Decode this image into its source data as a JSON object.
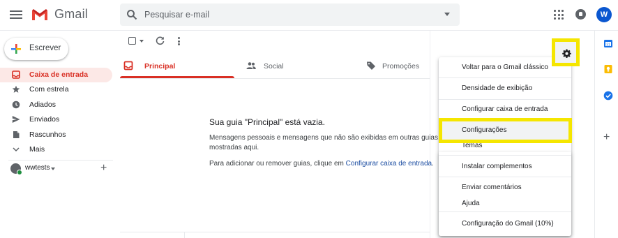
{
  "header": {
    "app_name": "Gmail",
    "search_placeholder": "Pesquisar e-mail",
    "avatar_initial": "W"
  },
  "sidebar": {
    "compose_label": "Escrever",
    "items": [
      {
        "label": "Caixa de entrada",
        "icon": "inbox-icon",
        "active": true
      },
      {
        "label": "Com estrela",
        "icon": "star-icon",
        "active": false
      },
      {
        "label": "Adiados",
        "icon": "clock-icon",
        "active": false
      },
      {
        "label": "Enviados",
        "icon": "send-icon",
        "active": false
      },
      {
        "label": "Rascunhos",
        "icon": "draft-icon",
        "active": false
      },
      {
        "label": "Mais",
        "icon": "chevron-down-icon",
        "active": false
      }
    ],
    "user": {
      "name": "wwtests"
    }
  },
  "tabs": [
    {
      "label": "Principal",
      "icon": "inbox-icon",
      "active": true
    },
    {
      "label": "Social",
      "icon": "people-icon",
      "active": false
    },
    {
      "label": "Promoções",
      "icon": "tag-icon",
      "active": false
    }
  ],
  "empty_state": {
    "title": "Sua guia \"Principal\" está vazia.",
    "line1": "Mensagens pessoais e mensagens que não são exibidas em outras guias s",
    "line2": "mostradas aqui.",
    "line3_prefix": "Para adicionar ou remover guias, clique em ",
    "line3_link": "Configurar caixa de entrada",
    "line3_suffix": "."
  },
  "settings_menu": {
    "items": [
      {
        "label": "Voltar para o Gmail clássico"
      },
      {
        "label": "Densidade de exibição"
      },
      {
        "label": "Configurar caixa de entrada"
      },
      {
        "label": "Configurações",
        "highlighted": true
      },
      {
        "label": "Temas"
      },
      {
        "label": "Instalar complementos"
      },
      {
        "label": "Enviar comentários"
      },
      {
        "label": "Ajuda"
      },
      {
        "label": "Configuração do Gmail (10%)"
      }
    ]
  },
  "colors": {
    "accent_red": "#d93025",
    "highlight_yellow": "#f5e600",
    "link_blue": "#1a4ca1",
    "avatar_blue": "#0b57d0"
  }
}
